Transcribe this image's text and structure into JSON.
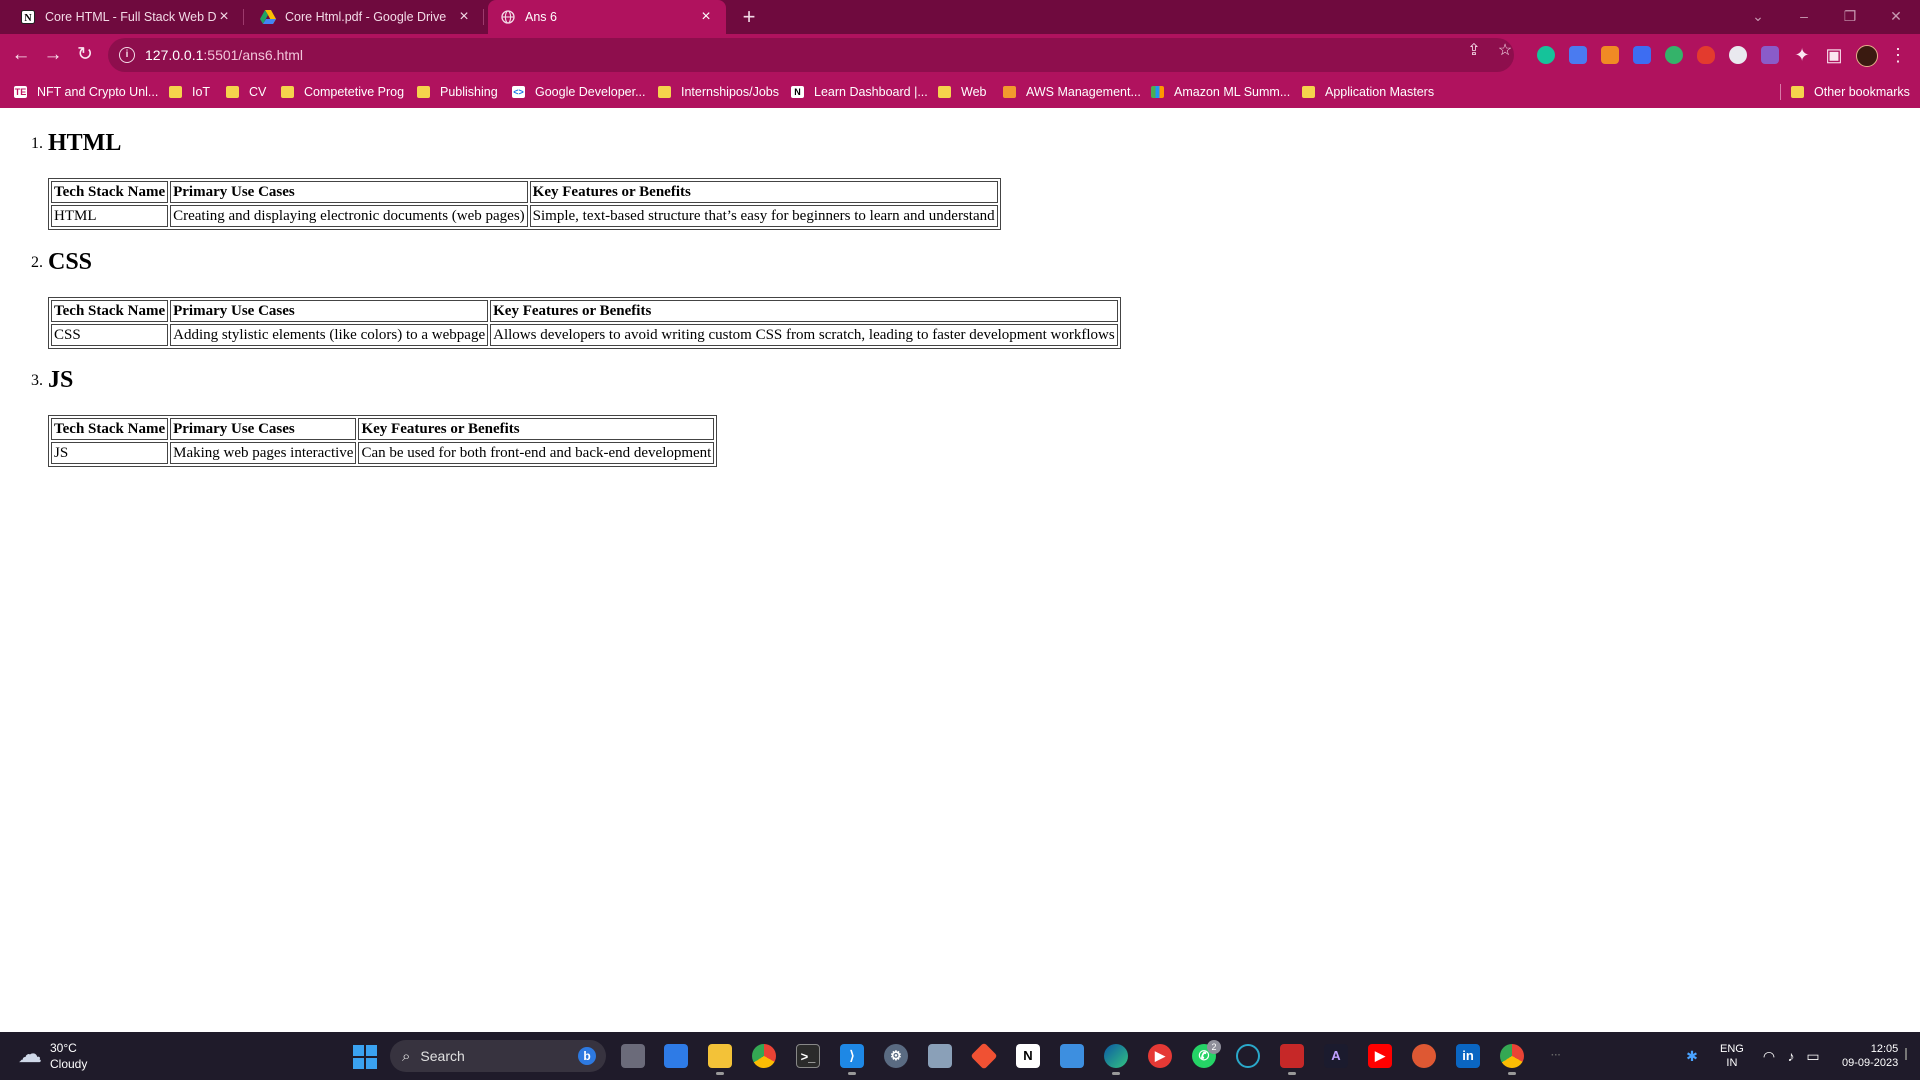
{
  "browser": {
    "tabs": [
      {
        "title": "Core HTML - Full Stack Web Dev",
        "favicon": "notion-icon",
        "active": false
      },
      {
        "title": "Core Html.pdf - Google Drive",
        "favicon": "google-drive-icon",
        "active": false
      },
      {
        "title": "Ans 6",
        "favicon": "globe-icon",
        "active": true
      }
    ],
    "url_host": "127.0.0.1",
    "url_rest": ":5501/ans6.html",
    "bookmarks": [
      "NFT and Crypto Unl...",
      "IoT",
      "CV",
      "Competetive Prog",
      "Publishing",
      "Google Developer...",
      "Internshipos/Jobs",
      "Learn Dashboard |...",
      "Web",
      "AWS Management...",
      "Amazon ML Summ...",
      "Application Masters"
    ],
    "other_bookmarks": "Other bookmarks",
    "theme_colors": {
      "frame": "#6f0a3e",
      "toolbar": "#b0125e",
      "omnibox": "#8e0e4d"
    }
  },
  "page": {
    "sections": [
      {
        "number": "1.",
        "heading": "HTML",
        "headers": [
          "Tech Stack Name",
          "Primary Use Cases",
          "Key Features or Benefits"
        ],
        "row": [
          "HTML",
          "Creating and displaying electronic documents (web pages)",
          "Simple, text-based structure that’s easy for beginners to learn and understand"
        ]
      },
      {
        "number": "2.",
        "heading": "CSS",
        "headers": [
          "Tech Stack Name",
          "Primary Use Cases",
          "Key Features or Benefits"
        ],
        "row": [
          "CSS",
          "Adding stylistic elements (like colors) to a webpage",
          "Allows developers to avoid writing custom CSS from scratch, leading to faster development workflows"
        ]
      },
      {
        "number": "3.",
        "heading": "JS",
        "headers": [
          "Tech Stack Name",
          "Primary Use Cases",
          "Key Features or Benefits"
        ],
        "row": [
          "JS",
          "Making web pages interactive",
          "Can be used for both front-end and back-end development"
        ]
      }
    ]
  },
  "taskbar": {
    "weather_temp": "30°C",
    "weather_desc": "Cloudy",
    "search_label": "Search",
    "whatsapp_badge": "2",
    "lang_line1": "ENG",
    "lang_line2": "IN",
    "time": "12:05",
    "date": "09-09-2023"
  }
}
